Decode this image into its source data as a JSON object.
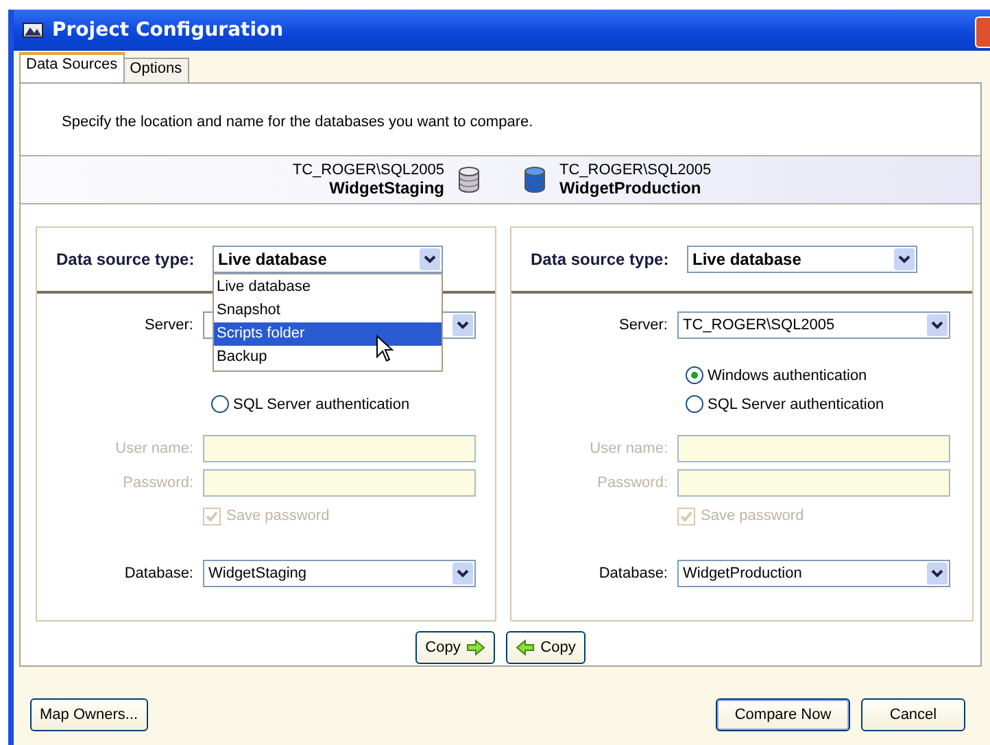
{
  "window": {
    "title": "Project Configuration"
  },
  "tabs": [
    {
      "label": "Data Sources",
      "selected": true
    },
    {
      "label": "Options",
      "selected": false
    }
  ],
  "instruction": "Specify the location and name for the databases you want to compare.",
  "header": [
    {
      "server": "TC_ROGER\\SQL2005",
      "database": "WidgetStaging",
      "active": false
    },
    {
      "server": "TC_ROGER\\SQL2005",
      "database": "WidgetProduction",
      "active": true
    }
  ],
  "sources": [
    {
      "type_label": "Data source type:",
      "type_value": "Live database",
      "dropdown_open": true,
      "dropdown_items": [
        {
          "label": "Live database",
          "selected": false
        },
        {
          "label": "Snapshot",
          "selected": false
        },
        {
          "label": "Scripts folder",
          "selected": true
        },
        {
          "label": "Backup",
          "selected": false
        }
      ],
      "server_label": "Server:",
      "auth_options": [
        {
          "label": "SQL Server authentication",
          "selected": false
        }
      ],
      "username_label": "User name:",
      "password_label": "Password:",
      "save_password": {
        "label": "Save password",
        "checked": true,
        "disabled": true
      },
      "database_label": "Database:",
      "database_value": "WidgetStaging"
    },
    {
      "type_label": "Data source type:",
      "type_value": "Live database",
      "dropdown_open": false,
      "server_label": "Server:",
      "server_value": "TC_ROGER\\SQL2005",
      "auth_options": [
        {
          "label": "Windows authentication",
          "selected": true
        },
        {
          "label": "SQL Server authentication",
          "selected": false
        }
      ],
      "username_label": "User name:",
      "password_label": "Password:",
      "save_password": {
        "label": "Save password",
        "checked": true,
        "disabled": true
      },
      "database_label": "Database:",
      "database_value": "WidgetProduction"
    }
  ],
  "copy_buttons": [
    {
      "label": "Copy",
      "kind": "forward"
    },
    {
      "label": "Copy",
      "kind": "back"
    }
  ],
  "buttons": {
    "left": [
      "Map Owners..."
    ],
    "right": [
      "Compare Now",
      "Cancel"
    ]
  }
}
